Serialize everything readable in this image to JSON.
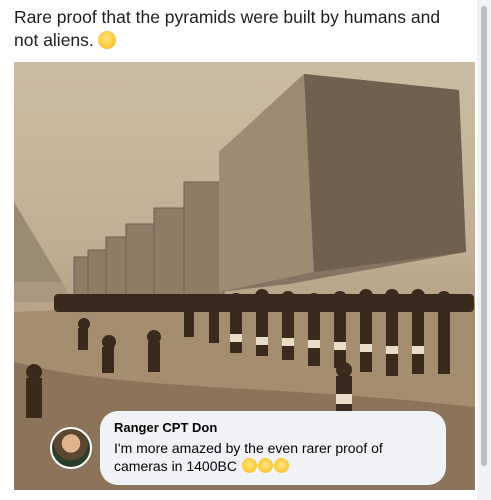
{
  "post": {
    "text": "Rare proof that the pyramids were built by humans and not aliens.",
    "emoji_icon": "ok-hand-emoji"
  },
  "comment": {
    "author": "Ranger CPT Don",
    "text": "I'm more amazed by the even rarer proof of cameras in 1400BC",
    "reaction_icons": [
      "laughing-emoji",
      "laughing-emoji",
      "laughing-emoji"
    ]
  }
}
